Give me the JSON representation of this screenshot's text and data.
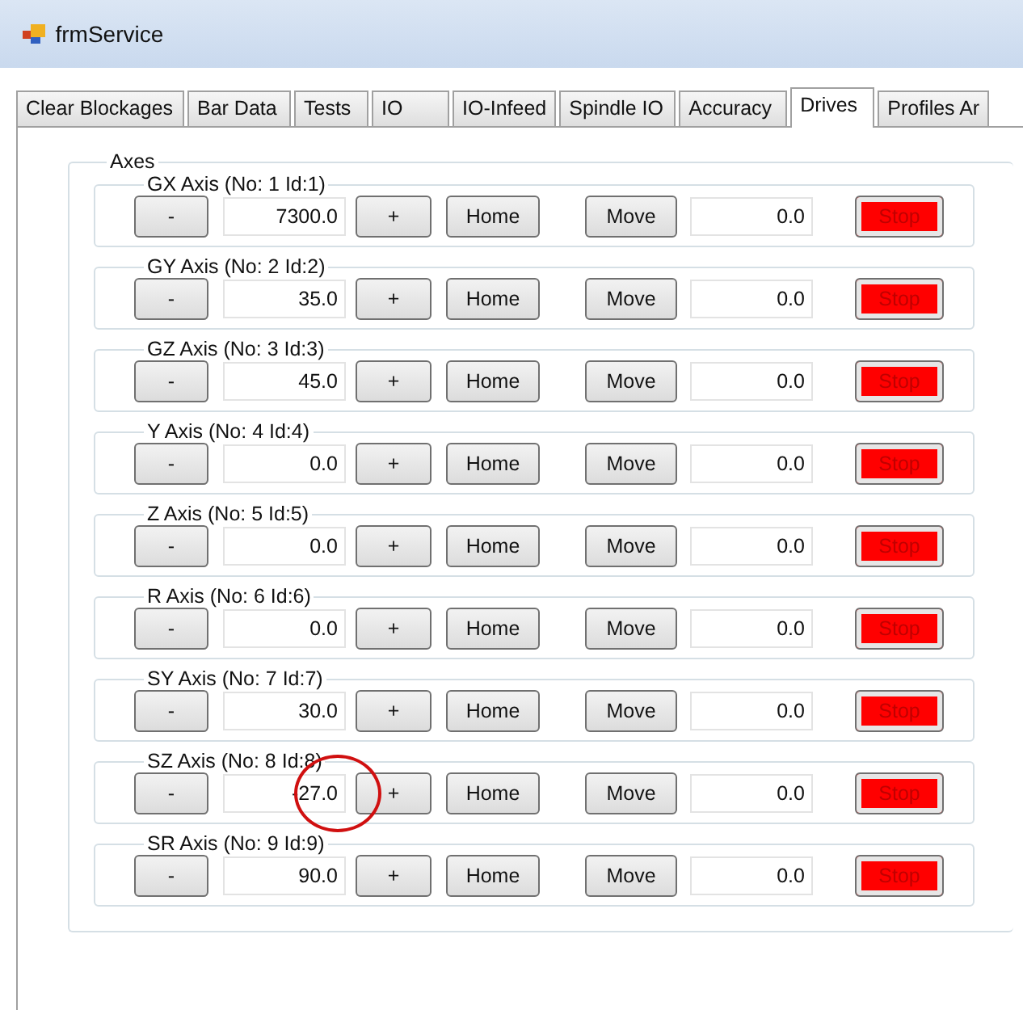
{
  "window": {
    "title": "frmService"
  },
  "tabs": [
    {
      "label": "Clear Blockages",
      "selected": false
    },
    {
      "label": "Bar Data",
      "selected": false
    },
    {
      "label": "Tests",
      "selected": false
    },
    {
      "label": "IO",
      "selected": false
    },
    {
      "label": "IO-Infeed",
      "selected": false
    },
    {
      "label": "Spindle IO",
      "selected": false
    },
    {
      "label": "Accuracy",
      "selected": false
    },
    {
      "label": "Drives",
      "selected": true
    },
    {
      "label": "Profiles Ar",
      "selected": false
    }
  ],
  "axes_group": {
    "title": "Axes",
    "axes": [
      {
        "title": "GX Axis (No: 1 Id:1)",
        "minus": "-",
        "value": "7300.0",
        "plus": "+",
        "home": "Home",
        "move": "Move",
        "move_value": "0.0",
        "stop": "Stop",
        "circled": false
      },
      {
        "title": "GY Axis (No: 2 Id:2)",
        "minus": "-",
        "value": "35.0",
        "plus": "+",
        "home": "Home",
        "move": "Move",
        "move_value": "0.0",
        "stop": "Stop",
        "circled": false
      },
      {
        "title": "GZ Axis (No: 3 Id:3)",
        "minus": "-",
        "value": "45.0",
        "plus": "+",
        "home": "Home",
        "move": "Move",
        "move_value": "0.0",
        "stop": "Stop",
        "circled": false
      },
      {
        "title": "Y Axis (No: 4 Id:4)",
        "minus": "-",
        "value": "0.0",
        "plus": "+",
        "home": "Home",
        "move": "Move",
        "move_value": "0.0",
        "stop": "Stop",
        "circled": false
      },
      {
        "title": "Z Axis (No: 5 Id:5)",
        "minus": "-",
        "value": "0.0",
        "plus": "+",
        "home": "Home",
        "move": "Move",
        "move_value": "0.0",
        "stop": "Stop",
        "circled": false
      },
      {
        "title": "R Axis (No: 6 Id:6)",
        "minus": "-",
        "value": "0.0",
        "plus": "+",
        "home": "Home",
        "move": "Move",
        "move_value": "0.0",
        "stop": "Stop",
        "circled": false
      },
      {
        "title": "SY Axis (No: 7 Id:7)",
        "minus": "-",
        "value": "30.0",
        "plus": "+",
        "home": "Home",
        "move": "Move",
        "move_value": "0.0",
        "stop": "Stop",
        "circled": false
      },
      {
        "title": "SZ Axis (No: 8 Id:8)",
        "minus": "-",
        "value": "-27.0",
        "plus": "+",
        "home": "Home",
        "move": "Move",
        "move_value": "0.0",
        "stop": "Stop",
        "circled": true
      },
      {
        "title": "SR Axis (No: 9 Id:9)",
        "minus": "-",
        "value": "90.0",
        "plus": "+",
        "home": "Home",
        "move": "Move",
        "move_value": "0.0",
        "stop": "Stop",
        "circled": false
      }
    ]
  }
}
